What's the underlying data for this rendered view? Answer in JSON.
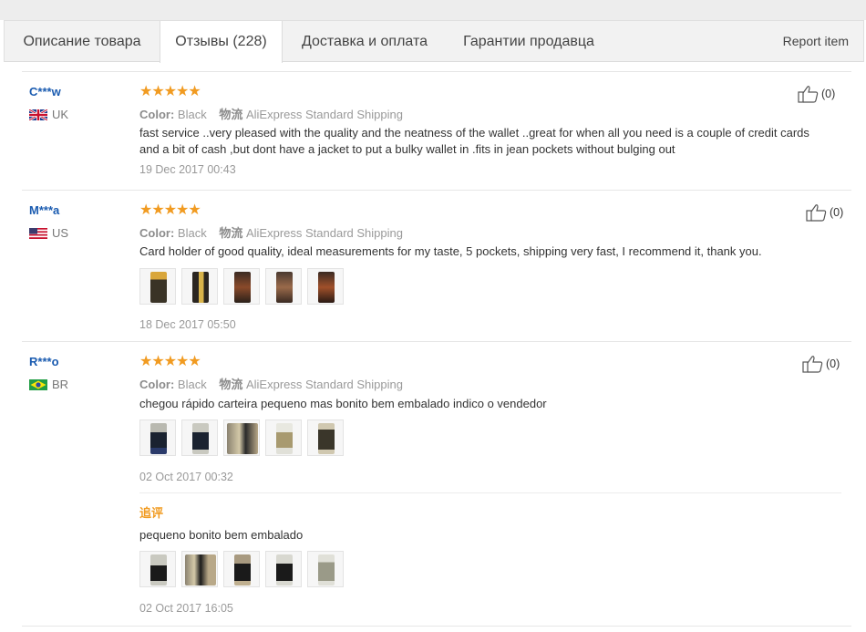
{
  "tabs": [
    {
      "label": "Описание товара"
    },
    {
      "label": "Отзывы (228)"
    },
    {
      "label": "Доставка и оплата"
    },
    {
      "label": "Гарантии продавца"
    }
  ],
  "report_label": "Report item",
  "labels": {
    "color": "Color:",
    "shipping": "物流",
    "additional": "追评"
  },
  "star_glyphs": "★★★★★",
  "reviews": [
    {
      "user": "C***w",
      "country": "UK",
      "rating": 5,
      "color_value": "Black",
      "shipping_value": "AliExpress Standard Shipping",
      "text": "fast service ..very pleased with the quality and the neatness of the wallet ..great for when all you need is a couple of credit cards and a bit of cash ,but dont have a jacket to put a bulky wallet in .fits in jean pockets without bulging out",
      "date": "19 Dec 2017 00:43",
      "helpful": "(0)"
    },
    {
      "user": "M***a",
      "country": "US",
      "rating": 5,
      "color_value": "Black",
      "shipping_value": "AliExpress Standard Shipping",
      "text": "Card holder of good quality, ideal measurements for my taste, 5 pockets, shipping very fast, I recommend it, thank you.",
      "date": "18 Dec 2017 05:50",
      "helpful": "(0)"
    },
    {
      "user": "R***o",
      "country": "BR",
      "rating": 5,
      "color_value": "Black",
      "shipping_value": "AliExpress Standard Shipping",
      "text": "chegou rápido carteira pequeno mas bonito bem embalado indico o vendedor",
      "date": "02 Oct 2017 00:32",
      "helpful": "(0)",
      "followup_text": "pequeno bonito bem embalado",
      "followup_date": "02 Oct 2017 16:05"
    }
  ],
  "colors": {
    "accent_star": "#f19b21",
    "username": "#1a5bb0"
  }
}
